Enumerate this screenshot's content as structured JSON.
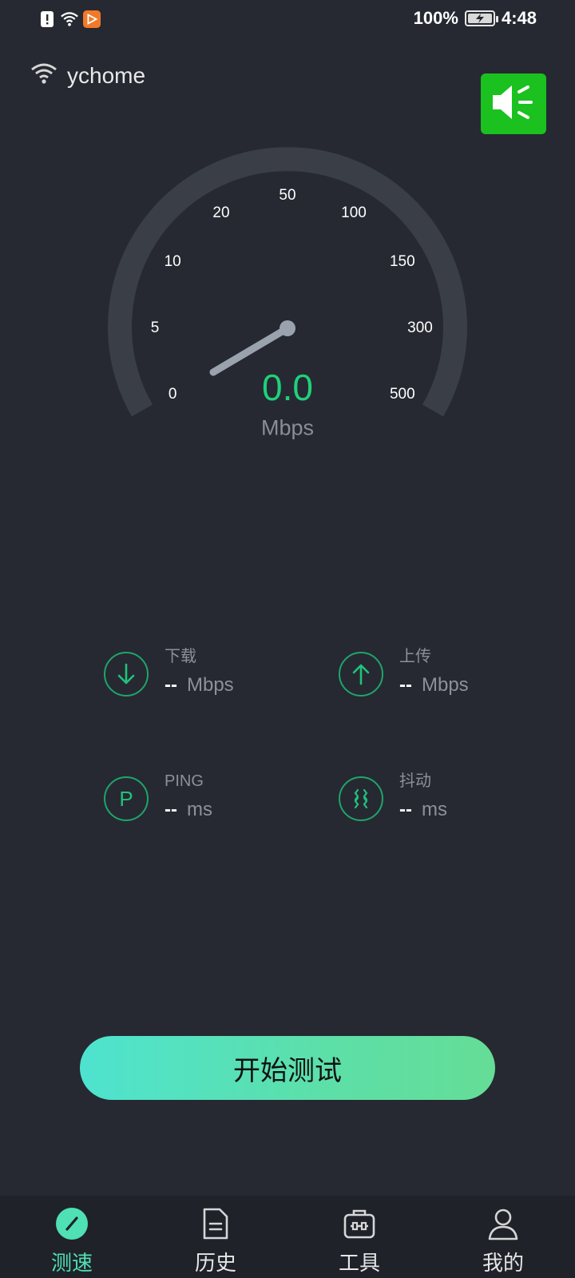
{
  "status_bar": {
    "battery_percent": "100%",
    "time": "4:48",
    "left_icons": [
      "alert-icon",
      "wifi-icon",
      "app-notification-icon"
    ]
  },
  "network": {
    "ssid": "ychome"
  },
  "gauge": {
    "tick_labels": [
      "0",
      "5",
      "10",
      "20",
      "50",
      "100",
      "150",
      "300",
      "500"
    ],
    "speed": "0.0",
    "unit": "Mbps",
    "needle_value": 0
  },
  "metrics": {
    "download": {
      "label": "下载",
      "value": "--",
      "unit": "Mbps"
    },
    "upload": {
      "label": "上传",
      "value": "--",
      "unit": "Mbps"
    },
    "ping": {
      "label": "PING",
      "icon_text": "P",
      "value": "--",
      "unit": "ms"
    },
    "jitter": {
      "label": "抖动",
      "value": "--",
      "unit": "ms"
    }
  },
  "start_button": {
    "label": "开始测试"
  },
  "nav": {
    "items": [
      {
        "label": "测速",
        "icon": "speedometer-icon",
        "active": true
      },
      {
        "label": "历史",
        "icon": "document-icon",
        "active": false
      },
      {
        "label": "工具",
        "icon": "toolbox-icon",
        "active": false
      },
      {
        "label": "我的",
        "icon": "person-icon",
        "active": false
      }
    ]
  },
  "colors": {
    "background": "#262932",
    "accent_green": "#1fd07a",
    "sound_button": "#1ac11f",
    "nav_active": "#4fe0b3"
  }
}
